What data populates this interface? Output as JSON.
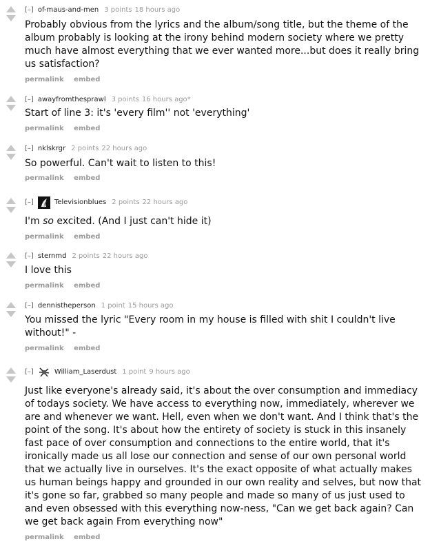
{
  "expand_label": "[–]",
  "buttons": {
    "permalink": "permalink",
    "embed": "embed"
  },
  "comments": [
    {
      "author": "of-maus-and-men",
      "score": "3 points",
      "time": "18 hours ago",
      "body": "Probably obvious from the lyrics and the album/song title, but the theme of the album probably is looking at the irony behind modern society where we pretty much have almost everything that we ever wanted more...but does it really bring us satisfaction?"
    },
    {
      "author": "awayfromthesprawl",
      "score": "3 points",
      "time": "16 hours ago*",
      "body": "Start of line 3: it's 'every film'' not 'everything'"
    },
    {
      "author": "nklskrgr",
      "score": "2 points",
      "time": "22 hours ago",
      "body": "So powerful. Can't wait to listen to this!"
    },
    {
      "author": "Televisionblues",
      "score": "2 points",
      "time": "22 hours ago",
      "body_before": "I'm ",
      "body_em": "so",
      "body_after": " excited. (And I just can't hide it)",
      "avatar_icon": "television-avatar-icon"
    },
    {
      "author": "sternmd",
      "score": "2 points",
      "time": "22 hours ago",
      "body": "I love this"
    },
    {
      "author": "dennistheperson",
      "score": "1 point",
      "time": "15 hours ago",
      "body": "You missed the lyric \"Every room in my house is filled with shit I couldn't live without!\" -"
    },
    {
      "author": "William_Laserdust",
      "score": "1 point",
      "time": "9 hours ago",
      "avatar_icon": "laserdust-avatar-icon",
      "body": "Just like everyone's already said, it's about the over consumption and immediacy of todays society. We have access to everything now, immediately, wherever we are and whenever we want. Hell, even when we don't want. And I think that's the point of the song. It's about how the entirety of society is stuck in this insanely fast pace of over consumption and connections to the entire world, that it's ironically made us all lose our connection and sense of our own personal world that we actually live in ourselves. It's the exact opposite of what actually makes us human beings happy and grounded in our own reality and selves, but now that it's gone so far, grabbed so many people and made so many of us just used to and even obsessed with this everything now-ness, \"Can we get back again? Can we get back again From everything now\""
    }
  ]
}
